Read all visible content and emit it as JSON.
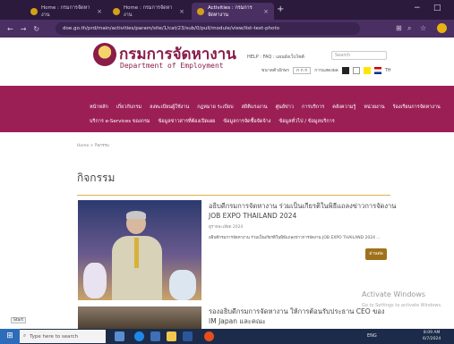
{
  "browser": {
    "tabs": [
      {
        "label": "Home : กรมการจัดหางาน",
        "active": false
      },
      {
        "label": "Home : กรมการจัดหางาน",
        "active": false
      },
      {
        "label": "Activities : กรมการจัดหางาน",
        "active": true
      }
    ],
    "url": "doe.go.th/prd/main/activities/param/site/1/cat/23/sub/0/pull/module/view/list-text-photo"
  },
  "header": {
    "logo_th": "กรมการจัดหางาน",
    "logo_en": "Department of Employment",
    "links": "HELP : FAQ : แผนผังเว็บไซต์",
    "search_placeholder": "Search",
    "font_size_label": "ขนาดตัวอักษร",
    "font_options": "ก ก ก",
    "contrast_label": "การแสดงผล",
    "language": "TH"
  },
  "menu": {
    "row1": [
      "หน้าหลัก",
      "เกี่ยวกับกรม",
      "ลงทะเบียนผู้ใช้งาน",
      "กฎหมาย ระเบียบ",
      "สถิติแรงงาน",
      "ศูนย์ข่าว",
      "การบริการ",
      "คลังความรู้",
      "หน่วยงาน",
      "ร้องเรียนการจัดหางาน"
    ],
    "row2": [
      "บริการ e-Services ของกรม",
      "ข้อมูลข่าวสารที่ต้องเปิดเผย",
      "ข้อมูลการจัดซื้อจัดจ้าง",
      "ข้อมูลทั่วไป / ข้อมูลบริการ"
    ]
  },
  "breadcrumb": "Home > กิจกรรม",
  "page_title": "กิจกรรม",
  "news": [
    {
      "title": "อธิบดีกรมการจัดหางาน ร่วมเป็นเกียรติในพิธีแถลงข่าวการจัดงาน JOB EXPO THAILAND 2024",
      "date": "ดูรายละเอียด 2024",
      "excerpt": "อธิบดีกรมการจัดหางาน ร่วมเป็นเกียรติในพิธีแถลงข่าวการจัดงาน JOB EXPO THAILAND 2024 ...",
      "more_label": "อ่านต่อ"
    },
    {
      "title": "รองอธิบดีกรมการจัดหางาน ให้การต้อนรับประธาน CEO ของ IM Japan และคณะ"
    }
  ],
  "watermark": {
    "title": "Activate Windows",
    "subtitle": "Go to Settings to activate Windows."
  },
  "start_tip": "Start",
  "taskbar": {
    "search_placeholder": "Type here to search",
    "tray": "ENG",
    "time": "8:09 AM",
    "date": "6/7/2024"
  }
}
